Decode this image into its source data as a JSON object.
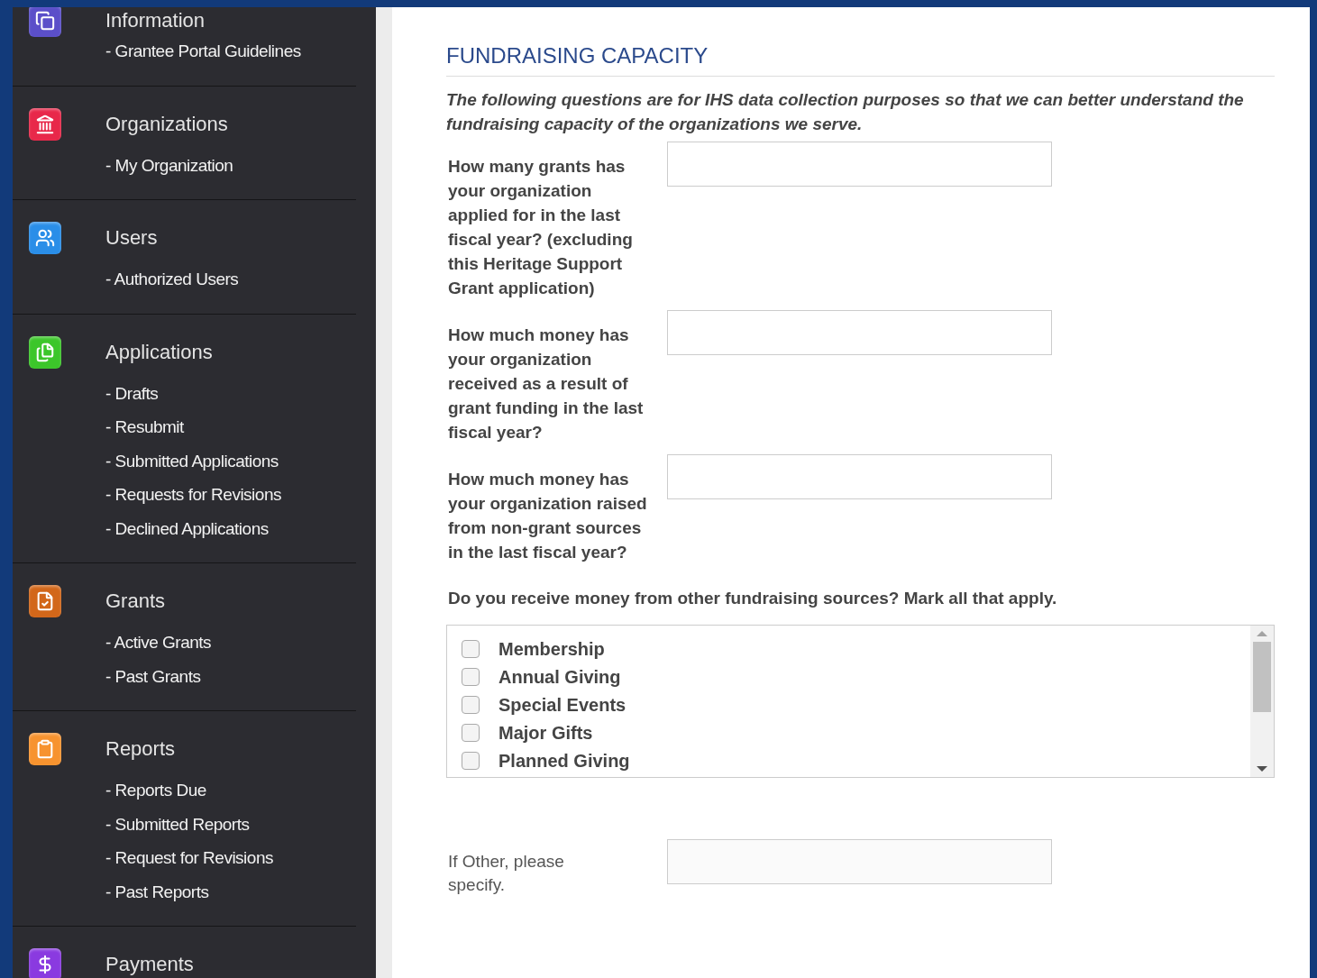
{
  "sidebar": {
    "sections": [
      {
        "title": "Information",
        "color": "#5b4fc9",
        "items": [
          "- Grantee Portal Guidelines"
        ]
      },
      {
        "title": "Organizations",
        "color": "#e8284a",
        "items": [
          "- My Organization"
        ]
      },
      {
        "title": "Users",
        "color": "#2a8ee8",
        "items": [
          "- Authorized Users"
        ]
      },
      {
        "title": "Applications",
        "color": "#3cc62a",
        "items": [
          "- Drafts",
          "- Resubmit",
          "- Submitted Applications",
          "- Requests for Revisions",
          "- Declined Applications"
        ]
      },
      {
        "title": "Grants",
        "color": "#d2671a",
        "items": [
          "- Active Grants",
          "- Past Grants"
        ]
      },
      {
        "title": "Reports",
        "color": "#f7932f",
        "items": [
          "- Reports Due",
          "- Submitted Reports",
          "- Request for Revisions",
          "- Past Reports"
        ]
      },
      {
        "title": "Payments",
        "color": "#8a3ae0"
      }
    ]
  },
  "form": {
    "heading": "FUNDRAISING CAPACITY",
    "intro": "The following questions are for IHS data collection purposes so that we can better understand the fundraising capacity of the organizations we serve.",
    "questions": [
      {
        "label": "How many grants has your organization applied for in the last fiscal year? (excluding this Heritage Support Grant application)"
      },
      {
        "label": "How much money has your organization received as a result of grant funding in the last fiscal year?"
      },
      {
        "label": "How much money has your organization raised from non-grant sources in the last fiscal year?"
      }
    ],
    "sources_question": "Do you receive money from other fundraising sources? Mark all that apply.",
    "sources": [
      {
        "label": "Membership",
        "checked": false
      },
      {
        "label": "Annual Giving",
        "checked": false
      },
      {
        "label": "Special Events",
        "checked": false
      },
      {
        "label": "Major Gifts",
        "checked": false
      },
      {
        "label": "Planned Giving",
        "checked": false
      }
    ],
    "other_label": "If Other, please specify."
  }
}
